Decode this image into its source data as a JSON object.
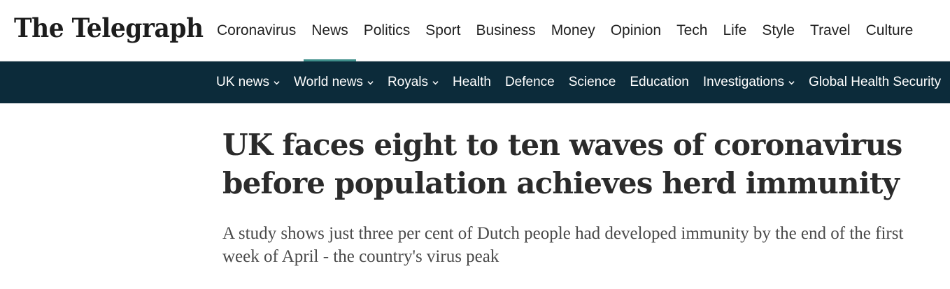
{
  "brand": {
    "logo_text": "The Telegraph"
  },
  "main_nav": {
    "items": [
      {
        "label": "Coronavirus"
      },
      {
        "label": "News",
        "active": true
      },
      {
        "label": "Politics"
      },
      {
        "label": "Sport"
      },
      {
        "label": "Business"
      },
      {
        "label": "Money"
      },
      {
        "label": "Opinion"
      },
      {
        "label": "Tech"
      },
      {
        "label": "Life"
      },
      {
        "label": "Style"
      },
      {
        "label": "Travel"
      },
      {
        "label": "Culture"
      }
    ]
  },
  "sub_nav": {
    "items": [
      {
        "label": "UK news",
        "dropdown": true
      },
      {
        "label": "World news",
        "dropdown": true
      },
      {
        "label": "Royals",
        "dropdown": true
      },
      {
        "label": "Health"
      },
      {
        "label": "Defence"
      },
      {
        "label": "Science"
      },
      {
        "label": "Education"
      },
      {
        "label": "Investigations",
        "dropdown": true
      },
      {
        "label": "Global Health Security"
      }
    ]
  },
  "article": {
    "headline": "UK faces eight to ten waves of coronavirus before population achieves herd immunity",
    "standfirst": "A study shows just three per cent of Dutch people had developed immunity by the end of the first week of April - the country's virus peak"
  },
  "colors": {
    "subnav_background": "#0c2b3a",
    "active_underline": "#3e8e8a"
  }
}
